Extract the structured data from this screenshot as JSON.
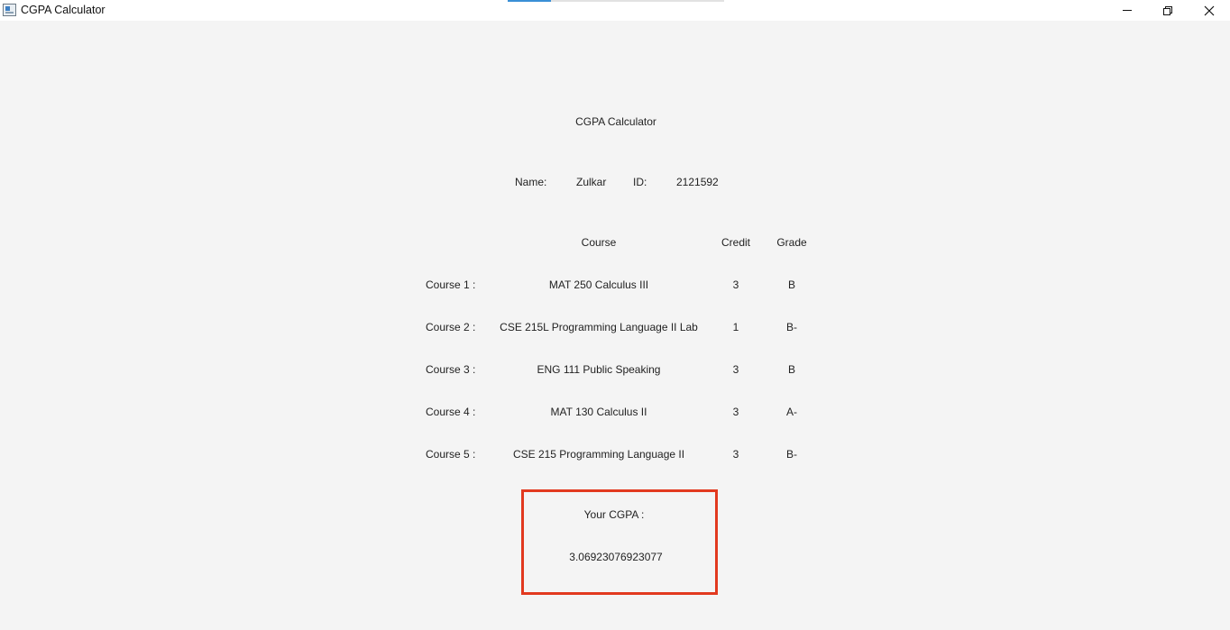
{
  "window": {
    "title": "CGPA Calculator",
    "controls": {
      "minimize": "minimize",
      "maximize": "restore",
      "close": "close"
    }
  },
  "header": {
    "title": "CGPA Calculator"
  },
  "student": {
    "name_label": "Name:",
    "name_value": "Zulkar",
    "id_label": "ID:",
    "id_value": "2121592"
  },
  "table": {
    "columns": {
      "course": "Course",
      "credit": "Credit",
      "grade": "Grade"
    },
    "rows": [
      {
        "label": "Course 1 :",
        "course": "MAT 250 Calculus III",
        "credit": "3",
        "grade": "B"
      },
      {
        "label": "Course 2 :",
        "course": "CSE 215L Programming Language II Lab",
        "credit": "1",
        "grade": "B-"
      },
      {
        "label": "Course 3 :",
        "course": "ENG 111 Public Speaking",
        "credit": "3",
        "grade": "B"
      },
      {
        "label": "Course 4 :",
        "course": "MAT 130 Calculus II",
        "credit": "3",
        "grade": "A-"
      },
      {
        "label": "Course 5 :",
        "course": "CSE 215 Programming Language II",
        "credit": "3",
        "grade": "B-"
      }
    ]
  },
  "result": {
    "label": "Your CGPA :",
    "value": "3.06923076923077",
    "highlight_color": "#e2391f"
  }
}
